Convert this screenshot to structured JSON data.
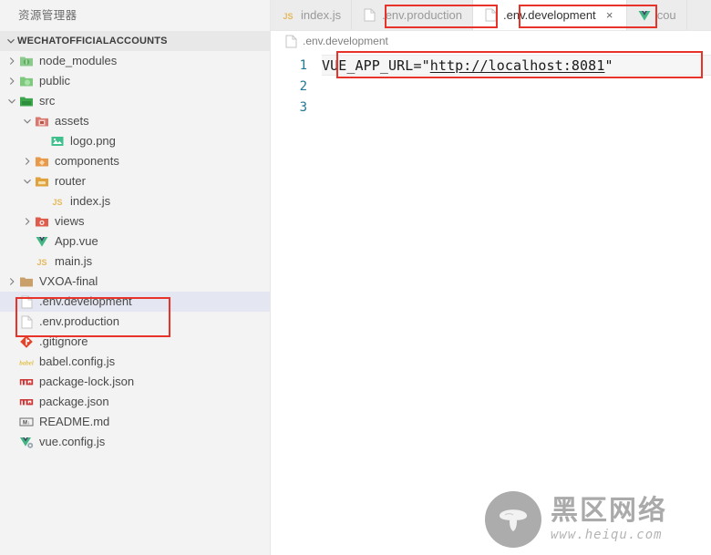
{
  "sidebar": {
    "title": "资源管理器",
    "root": {
      "label": "WECHATOFFICIALACCOUNTS",
      "twisty": "chevron-down-icon"
    },
    "items": [
      {
        "label": "node_modules",
        "icon": "folder-node-modules-icon",
        "twisty": "chevron-right-icon",
        "indent": 1,
        "selected": false
      },
      {
        "label": "public",
        "icon": "folder-public-icon",
        "twisty": "chevron-right-icon",
        "indent": 1,
        "selected": false
      },
      {
        "label": "src",
        "icon": "folder-src-icon",
        "twisty": "chevron-down-icon",
        "indent": 1,
        "selected": false
      },
      {
        "label": "assets",
        "icon": "folder-assets-icon",
        "twisty": "chevron-down-icon",
        "indent": 2,
        "selected": false
      },
      {
        "label": "logo.png",
        "icon": "image-file-icon",
        "twisty": "none",
        "indent": 3,
        "selected": false
      },
      {
        "label": "components",
        "icon": "folder-components-icon",
        "twisty": "chevron-right-icon",
        "indent": 2,
        "selected": false
      },
      {
        "label": "router",
        "icon": "folder-router-icon",
        "twisty": "chevron-down-icon",
        "indent": 2,
        "selected": false
      },
      {
        "label": "index.js",
        "icon": "js-file-icon",
        "twisty": "none",
        "indent": 3,
        "selected": false
      },
      {
        "label": "views",
        "icon": "folder-views-icon",
        "twisty": "chevron-right-icon",
        "indent": 2,
        "selected": false
      },
      {
        "label": "App.vue",
        "icon": "vue-file-icon",
        "twisty": "none",
        "indent": 2,
        "selected": false
      },
      {
        "label": "main.js",
        "icon": "js-file-icon",
        "twisty": "none",
        "indent": 2,
        "selected": false
      },
      {
        "label": "VXOA-final",
        "icon": "folder-plain-icon",
        "twisty": "chevron-right-icon",
        "indent": 1,
        "selected": false
      },
      {
        "label": ".env.development",
        "icon": "plain-file-icon",
        "twisty": "none",
        "indent": 1,
        "selected": true
      },
      {
        "label": ".env.production",
        "icon": "plain-file-icon",
        "twisty": "none",
        "indent": 1,
        "selected": false
      },
      {
        "label": ".gitignore",
        "icon": "git-file-icon",
        "twisty": "none",
        "indent": 1,
        "selected": false
      },
      {
        "label": "babel.config.js",
        "icon": "babel-file-icon",
        "twisty": "none",
        "indent": 1,
        "selected": false
      },
      {
        "label": "package-lock.json",
        "icon": "npm-file-icon",
        "twisty": "none",
        "indent": 1,
        "selected": false
      },
      {
        "label": "package.json",
        "icon": "npm-file-icon",
        "twisty": "none",
        "indent": 1,
        "selected": false
      },
      {
        "label": "README.md",
        "icon": "markdown-file-icon",
        "twisty": "none",
        "indent": 1,
        "selected": false
      },
      {
        "label": "vue.config.js",
        "icon": "vue-config-file-icon",
        "twisty": "none",
        "indent": 1,
        "selected": false
      }
    ]
  },
  "tabs": [
    {
      "label": "index.js",
      "icon": "js-file-icon",
      "active": false,
      "closable": false
    },
    {
      "label": ".env.production",
      "icon": "plain-file-icon",
      "active": false,
      "closable": false
    },
    {
      "label": ".env.development",
      "icon": "plain-file-icon",
      "active": true,
      "closable": true,
      "close_glyph": "×"
    },
    {
      "label": "cou",
      "icon": "vue-file-icon",
      "active": false,
      "closable": false
    }
  ],
  "breadcrumb": {
    "label": ".env.development",
    "icon": "plain-file-icon"
  },
  "editor": {
    "lines": [
      {
        "number": "1",
        "text": "VUE_APP_URL=\"http://localhost:8081\"",
        "prefix": "VUE_APP_URL=\"",
        "url": "http://localhost:8081",
        "suffix": "\"",
        "current": true
      },
      {
        "number": "2",
        "text": "",
        "prefix": "",
        "url": "",
        "suffix": "",
        "current": false
      },
      {
        "number": "3",
        "text": "",
        "prefix": "",
        "url": "",
        "suffix": "",
        "current": false
      }
    ]
  },
  "watermark": {
    "cn_text": "黑区网络",
    "url_text": "www.heiqu.com"
  },
  "colors": {
    "annotation_red": "#e8332a",
    "line_number_blue": "#237893",
    "sidebar_bg": "#f3f3f3",
    "selection_bg": "#e4e6f1",
    "editor_bg": "#ffffff"
  }
}
